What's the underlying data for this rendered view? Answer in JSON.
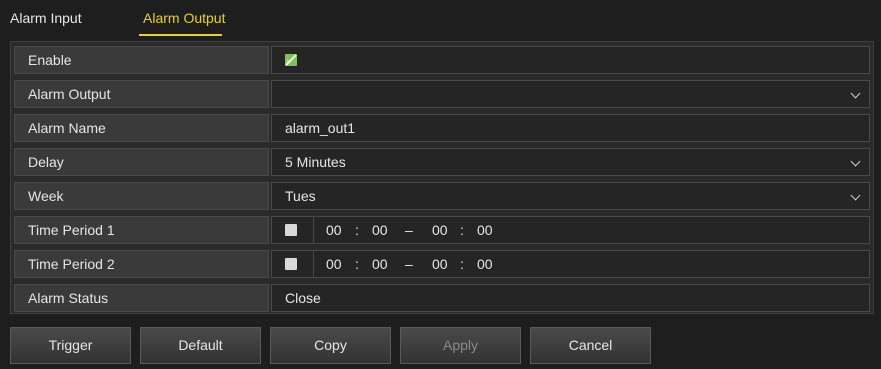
{
  "tabs": [
    {
      "label": "Alarm Input",
      "active": false
    },
    {
      "label": "Alarm Output",
      "active": true
    }
  ],
  "colors": {
    "accent": "#e8cf2a",
    "checkbox_on": "#7fc256"
  },
  "form": {
    "enable": {
      "label": "Enable",
      "checked": true
    },
    "alarm_output": {
      "label": "Alarm Output",
      "value": ""
    },
    "alarm_name": {
      "label": "Alarm Name",
      "value": "alarm_out1"
    },
    "delay": {
      "label": "Delay",
      "value": "5 Minutes"
    },
    "week": {
      "label": "Week",
      "value": "Tues"
    },
    "time_period_1": {
      "label": "Time Period 1",
      "checked": false,
      "start_h": "00",
      "start_m": "00",
      "sep": ":",
      "dash": "–",
      "end_h": "00",
      "end_m": "00"
    },
    "time_period_2": {
      "label": "Time Period 2",
      "checked": false,
      "start_h": "00",
      "start_m": "00",
      "sep": ":",
      "dash": "–",
      "end_h": "00",
      "end_m": "00"
    },
    "alarm_status": {
      "label": "Alarm Status",
      "value": "Close"
    }
  },
  "buttons": {
    "trigger": "Trigger",
    "default": "Default",
    "copy": "Copy",
    "apply": "Apply",
    "cancel": "Cancel"
  }
}
